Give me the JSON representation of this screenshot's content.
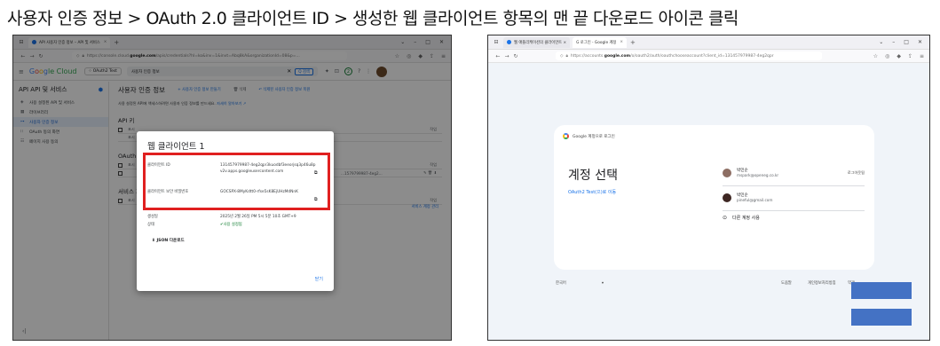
{
  "page_title": "사용자 인증 정보 > OAuth 2.0 클라이언트 ID > 생성한 웹 클라이언트 항목의 맨 끝 다운로드 아이콘 클릭",
  "left": {
    "tab_title": "API 사용자 인증 정보 – API 및 서비스",
    "url_prefix": "https://console.cloud.",
    "url_domain": "google.com",
    "url_rest": "/apis/credentials?hl=ko&inv=1&invt=Abq8kA&organizationId=08&p=...",
    "gcp": {
      "logo": [
        "G",
        "o",
        "o",
        "g",
        "le Cloud"
      ],
      "project": "OAuth2 Test",
      "search_value": "사용자 인증 정보",
      "search_button": "Q 검색",
      "notif_count": "2"
    },
    "sidebar": {
      "title": "API  API 및 서비스",
      "items": [
        {
          "icon": "◈",
          "label": "사용 설정된 API 및 서비스"
        },
        {
          "icon": "▦",
          "label": "라이브러리"
        },
        {
          "icon": "⊶",
          "label": "사용자 인증 정보"
        },
        {
          "icon": "⁝⁝",
          "label": "OAuth 동의 화면"
        },
        {
          "icon": "☷",
          "label": "페이지 사용 동의"
        }
      ]
    },
    "main": {
      "heading": "사용자 인증 정보",
      "create_action": "+ 사용자 인증 정보 만들기",
      "delete_action": "🗑 삭제",
      "restore_action": "↶ 삭제된 사용자 인증 정보 복원",
      "intro": "사용 설정된 API에 액세스하려면 사용자 인증 정보를 만드세요.",
      "intro_link": "자세히 알아보기 ↗",
      "api_keys": "API 키",
      "oauth": "OAuth 2.0 클라이언트 ID",
      "service": "서비스 계정",
      "action_col": "작업",
      "manage_service": "서비스 계정 관리",
      "client_id_short": "...1579799987-4eg2...",
      "name_col": "표시"
    },
    "dialog": {
      "title": "웹 클라이언트 1",
      "client_id_label": "클라이언트 ID",
      "client_id_value": "131457979987-4eg2qpr3kuodbf3eeorjsq3p46u8pv2v.apps.googleusercontent.com",
      "secret_label": "클라이언트 보안 비밀번호",
      "secret_value": "GOCSPX-8MyKdtt0-rfse5sK8EjUHzMdNnK",
      "created_label": "생성일",
      "created_value": "2025년 2월 26일 PM 5시 5분 10초 GMT+9",
      "state_label": "상태",
      "state_value": "✔사용 설정됨",
      "json_download": "⬇ JSON 다운로드",
      "ok": "닫기"
    }
  },
  "right": {
    "tab1": "웹 애플리케이션의 클라이언트 ×",
    "tab2": "G  로그인 - Google 계정",
    "url_prefix": "https://accounts.",
    "url_domain": "google.com",
    "url_rest": "/o/oauth2/auth/oauthchooseaccount?client_id=131457979987-4eg2qpr",
    "login": {
      "head": "Google 계정으로 로그인",
      "title": "계정 선택",
      "subtitle": "OAuth2 Test(으)로 이동",
      "accounts": [
        {
          "name": "박민순",
          "email": "mspark@openeg.co.kr",
          "right": "로그아웃됨"
        },
        {
          "name": "박민순",
          "email": "pineful@gmail.com",
          "right": ""
        }
      ],
      "other": "다른 계정 사용"
    },
    "footer": {
      "lang": "한국어",
      "help": "도움말",
      "privacy": "개인정보처리방침",
      "terms": "약관"
    }
  },
  "colors": {
    "highlight": "#e02020",
    "google_blue": "#1a73e8",
    "block_blue": "#4472c4"
  }
}
